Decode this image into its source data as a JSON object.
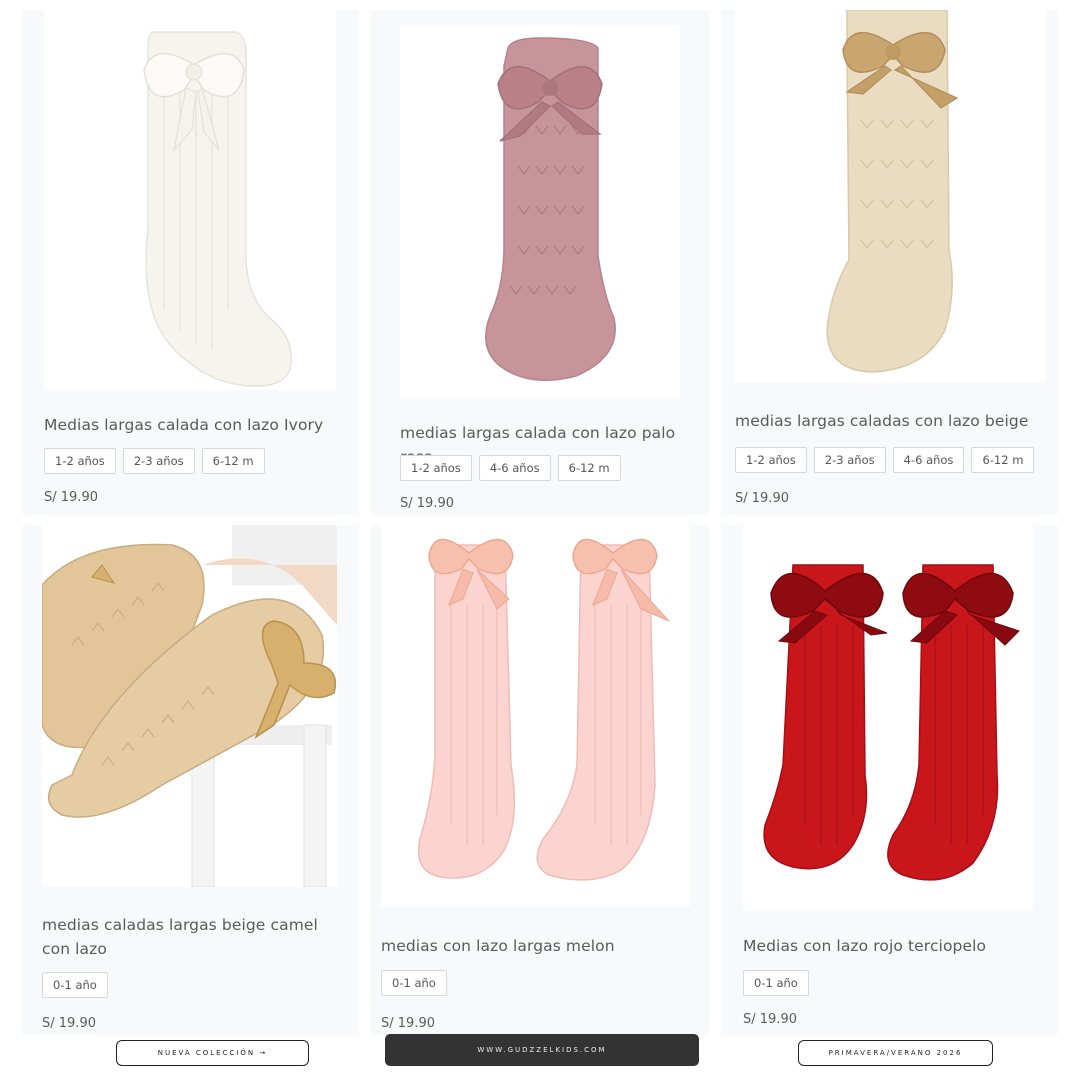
{
  "products": [
    {
      "title": "Medias largas calada con lazo Ivory",
      "sizes": [
        "1-2 años",
        "2-3 años",
        "6-12 m"
      ],
      "price": "S/ 19.90",
      "colors": {
        "sock": "#f6f4ef",
        "bow": "#f8f7f2",
        "shade": "#e4e1da"
      }
    },
    {
      "title": "medias largas calada con lazo palo rosa",
      "sizes": [
        "1-2 años",
        "4-6 años",
        "6-12 m"
      ],
      "price": "S/ 19.90",
      "colors": {
        "sock": "#c8949c",
        "bow": "#b98088",
        "shade": "#a9717a"
      }
    },
    {
      "title": "medias largas caladas con lazo beige",
      "sizes": [
        "1-2 años",
        "2-3 años",
        "4-6 años",
        "6-12 m"
      ],
      "price": "S/ 19.90",
      "colors": {
        "sock": "#e9dcc0",
        "bow": "#c9a670",
        "shade": "#d6c6a3"
      }
    },
    {
      "title": "medias caladas largas beige camel con lazo",
      "sizes": [
        "0-1 año"
      ],
      "price": "S/ 19.90",
      "colors": {
        "sock": "#e2c69a",
        "bow": "#d8b06e",
        "shade": "#c8ab80"
      }
    },
    {
      "title": "medias con lazo largas melon",
      "sizes": [
        "0-1 año"
      ],
      "price": "S/ 19.90",
      "colors": {
        "sock": "#fbd3cf",
        "bow": "#f7c0ae",
        "shade": "#f0bcb6"
      }
    },
    {
      "title": "Medias con lazo rojo terciopelo",
      "sizes": [
        "0-1 año"
      ],
      "price": "S/ 19.90",
      "colors": {
        "sock": "#c8161b",
        "bow": "#8e0b12",
        "shade": "#a50f15"
      }
    }
  ],
  "footer": {
    "left_label": "NUEVA COLECCIÓN →",
    "center_label": "WWW.GUDZZELKIDS.COM",
    "right_label": "PRIMAVERA/VERANO 2026"
  },
  "theme": {
    "card_bg": "#f8f9fa",
    "text": "#5a5a5a",
    "dark_pill": "#333333"
  }
}
